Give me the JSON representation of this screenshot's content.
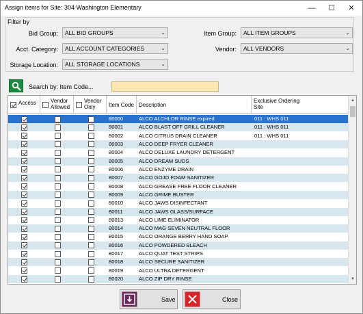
{
  "window": {
    "title": "Assign items for Site: 304  Washington Elementary",
    "min_glyph": "—",
    "max_glyph": "☐",
    "close_glyph": "✕"
  },
  "filter": {
    "title": "Filter by",
    "bid_group_label": "Bid Group:",
    "bid_group_value": "ALL BID GROUPS",
    "item_group_label": "Item Group:",
    "item_group_value": "ALL ITEM GROUPS",
    "acct_category_label": "Acct. Category:",
    "acct_category_value": "ALL ACCOUNT CATEGORIES",
    "vendor_label": "Vendor:",
    "vendor_value": "ALL VENDORS",
    "storage_location_label": "Storage Location:",
    "storage_location_value": "ALL STORAGE LOCATIONS",
    "dropdown_glyph": "⌄"
  },
  "search": {
    "label": "Search by: Item Code...",
    "value": "",
    "icon": "search-icon"
  },
  "grid": {
    "headers": {
      "access": "Access",
      "vendor_allowed": "Vendor Allowed",
      "vendor_only": "Vendor Only",
      "item_code": "Item Code",
      "description": "Description",
      "exclusive_site": "Exclusive Ordering Site"
    },
    "header_access_checked": true,
    "rows": [
      {
        "access": true,
        "vendor_allowed": false,
        "vendor_only": false,
        "code": "80000",
        "desc": "ALCO ALCHLOR RINSE expired",
        "site": "011 : WHS 011"
      },
      {
        "access": true,
        "vendor_allowed": false,
        "vendor_only": false,
        "code": "80001",
        "desc": "ALCO BLAST OFF GRILL CLEANER",
        "site": "011 : WHS 011"
      },
      {
        "access": true,
        "vendor_allowed": false,
        "vendor_only": false,
        "code": "80002",
        "desc": "ALCO CITRUS DRAIN CLEANER",
        "site": "011 : WHS 011"
      },
      {
        "access": true,
        "vendor_allowed": false,
        "vendor_only": false,
        "code": "80003",
        "desc": "ALCO DEEP FRYER CLEANER",
        "site": ""
      },
      {
        "access": true,
        "vendor_allowed": false,
        "vendor_only": false,
        "code": "80004",
        "desc": "ALCO DELUXE LAUNDRY DETERGENT",
        "site": ""
      },
      {
        "access": true,
        "vendor_allowed": false,
        "vendor_only": false,
        "code": "80005",
        "desc": "ALCO DREAM SUDS",
        "site": ""
      },
      {
        "access": true,
        "vendor_allowed": false,
        "vendor_only": false,
        "code": "80006",
        "desc": "ALCO ENZYME DRAIN",
        "site": ""
      },
      {
        "access": true,
        "vendor_allowed": false,
        "vendor_only": false,
        "code": "80007",
        "desc": "ALCO GOJO FOAM SANITIZER",
        "site": ""
      },
      {
        "access": true,
        "vendor_allowed": false,
        "vendor_only": false,
        "code": "80008",
        "desc": "ALCO GREASE FREE FLOOR CLEANER",
        "site": ""
      },
      {
        "access": true,
        "vendor_allowed": false,
        "vendor_only": false,
        "code": "80009",
        "desc": "ALCO GRIME BUSTER",
        "site": ""
      },
      {
        "access": true,
        "vendor_allowed": false,
        "vendor_only": false,
        "code": "80010",
        "desc": "ALCO JAWS DISINFECTANT",
        "site": ""
      },
      {
        "access": true,
        "vendor_allowed": false,
        "vendor_only": false,
        "code": "80011",
        "desc": "ALCO JAWS GLASS/SURFACE",
        "site": ""
      },
      {
        "access": true,
        "vendor_allowed": false,
        "vendor_only": false,
        "code": "80013",
        "desc": "ALCO LIME ELIMINATOR",
        "site": ""
      },
      {
        "access": true,
        "vendor_allowed": false,
        "vendor_only": false,
        "code": "80014",
        "desc": "ALCO MAG SEVEN NEUTRAL FLOOR",
        "site": ""
      },
      {
        "access": true,
        "vendor_allowed": false,
        "vendor_only": false,
        "code": "80015",
        "desc": "ALCO ORANGE BERRY HAND SOAP",
        "site": ""
      },
      {
        "access": true,
        "vendor_allowed": false,
        "vendor_only": false,
        "code": "80016",
        "desc": "ALCO POWDERED BLEACH",
        "site": ""
      },
      {
        "access": true,
        "vendor_allowed": false,
        "vendor_only": false,
        "code": "80017",
        "desc": "ALCO QUAT TEST STRIPS",
        "site": ""
      },
      {
        "access": true,
        "vendor_allowed": false,
        "vendor_only": false,
        "code": "80018",
        "desc": "ALCO SECURE SANITIZER",
        "site": ""
      },
      {
        "access": true,
        "vendor_allowed": false,
        "vendor_only": false,
        "code": "80019",
        "desc": "ALCO ULTRA DETERGENT",
        "site": ""
      },
      {
        "access": true,
        "vendor_allowed": false,
        "vendor_only": false,
        "code": "80020",
        "desc": "ALCO ZIP DRY RINSE",
        "site": ""
      }
    ],
    "selected_row": 0
  },
  "buttons": {
    "save_label": "Save",
    "close_label": "Close"
  },
  "colors": {
    "selected_row": "#2a72d0",
    "alt_row": "#d8e6ee",
    "search_field": "#fde8b4",
    "search_button": "#1c8b3f",
    "save_icon": "#6b2a5e",
    "close_icon": "#d9262b"
  }
}
